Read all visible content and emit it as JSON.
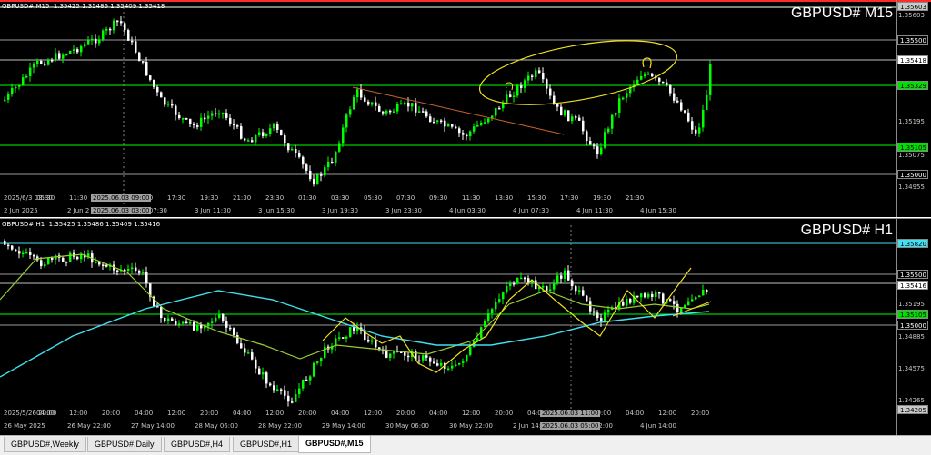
{
  "colors": {
    "background": "#000000",
    "bull_candle": "#00ff00",
    "bear_candle": "#ffffff",
    "ma_fast": "#9acd32",
    "ma_slow": "#40e0f0",
    "annotation": "#f0e020",
    "trendline": "#c86428",
    "level_line": "#00ff00",
    "cyan_level": "#40e0f0",
    "separator": "#8a8a8a"
  },
  "m15": {
    "header": "GBPUSD#,M15  1.35425 1.35486 1.35409 1.35418",
    "title": "GBPUSD# M15",
    "price_labels": [
      "1.35500",
      "1.35418",
      "1.35329",
      "1.35195",
      "1.35105",
      "1.35075",
      "1.35000",
      "1.34955"
    ],
    "price_boxes": {
      "top": "1.35603",
      "bid": "1.35418",
      "green1": "1.35329",
      "green2": "1.35105",
      "level": "1.35500",
      "low": "1.35000"
    },
    "time_labels": [
      "2025/6/3 03:30",
      "05:30",
      "11:30",
      "13:30",
      "15:30",
      "17:30",
      "19:30",
      "21:30",
      "23:30",
      "01:30",
      "03:30",
      "05:30",
      "07:30",
      "09:30",
      "11:30",
      "13:30",
      "15:30",
      "17:30",
      "19:30",
      "21:30"
    ],
    "time_box": "2025.06.03 09:00",
    "date_labels": [
      "2 Jun 2025",
      "2 Jun 2",
      "3 Jun 07:30",
      "3 Jun 11:30",
      "3 Jun 15:30",
      "3 Jun 19:30",
      "3 Jun 23:30",
      "4 Jun 03:30",
      "4 Jun 07:30",
      "4 Jun 11:30",
      "4 Jun 15:30"
    ],
    "date_box": "2025.06.03 03:00"
  },
  "h1": {
    "header": "GBPUSD#,H1  1.35425 1.35486 1.35409 1.35416",
    "title": "GBPUSD# H1",
    "price_labels": [
      "1.35500",
      "1.35416",
      "1.35195",
      "1.35105",
      "1.34885",
      "1.34575",
      "1.34265",
      "1.34205"
    ],
    "price_boxes": {
      "cyan": "1.35820",
      "level": "1.35500",
      "bid": "1.35416",
      "green": "1.35105",
      "low": "1.35000"
    },
    "time_labels": [
      "2025/5/26 20:00",
      "04:00",
      "12:00",
      "20:00",
      "04:00",
      "12:00",
      "20:00",
      "04:00",
      "12:00",
      "20:00",
      "04:00",
      "12:00",
      "20:00",
      "04:00",
      "12:00",
      "20:00",
      "04:00",
      "12:00",
      "20:00",
      "04:00",
      "12:00",
      "20:00"
    ],
    "time_box": "2025.06.03 11:00",
    "date_labels": [
      "26 May 2025",
      "26 May 22:00",
      "27 May 14:00",
      "28 May 06:00",
      "28 May 22:00",
      "29 May 14:00",
      "30 May 06:00",
      "30 May 22:00",
      "2 Jun 14:00",
      "3 Jun 22:00",
      "4 Jun 14:00"
    ],
    "date_box": "2025.06.03 05:00"
  },
  "tabs": [
    "GBPUSD#,Weekly",
    "GBPUSD#,Daily",
    "GBPUSD#,H4",
    "GBPUSD#,H1",
    "GBPUSD#,M15"
  ],
  "active_tab": "GBPUSD#,M15"
}
